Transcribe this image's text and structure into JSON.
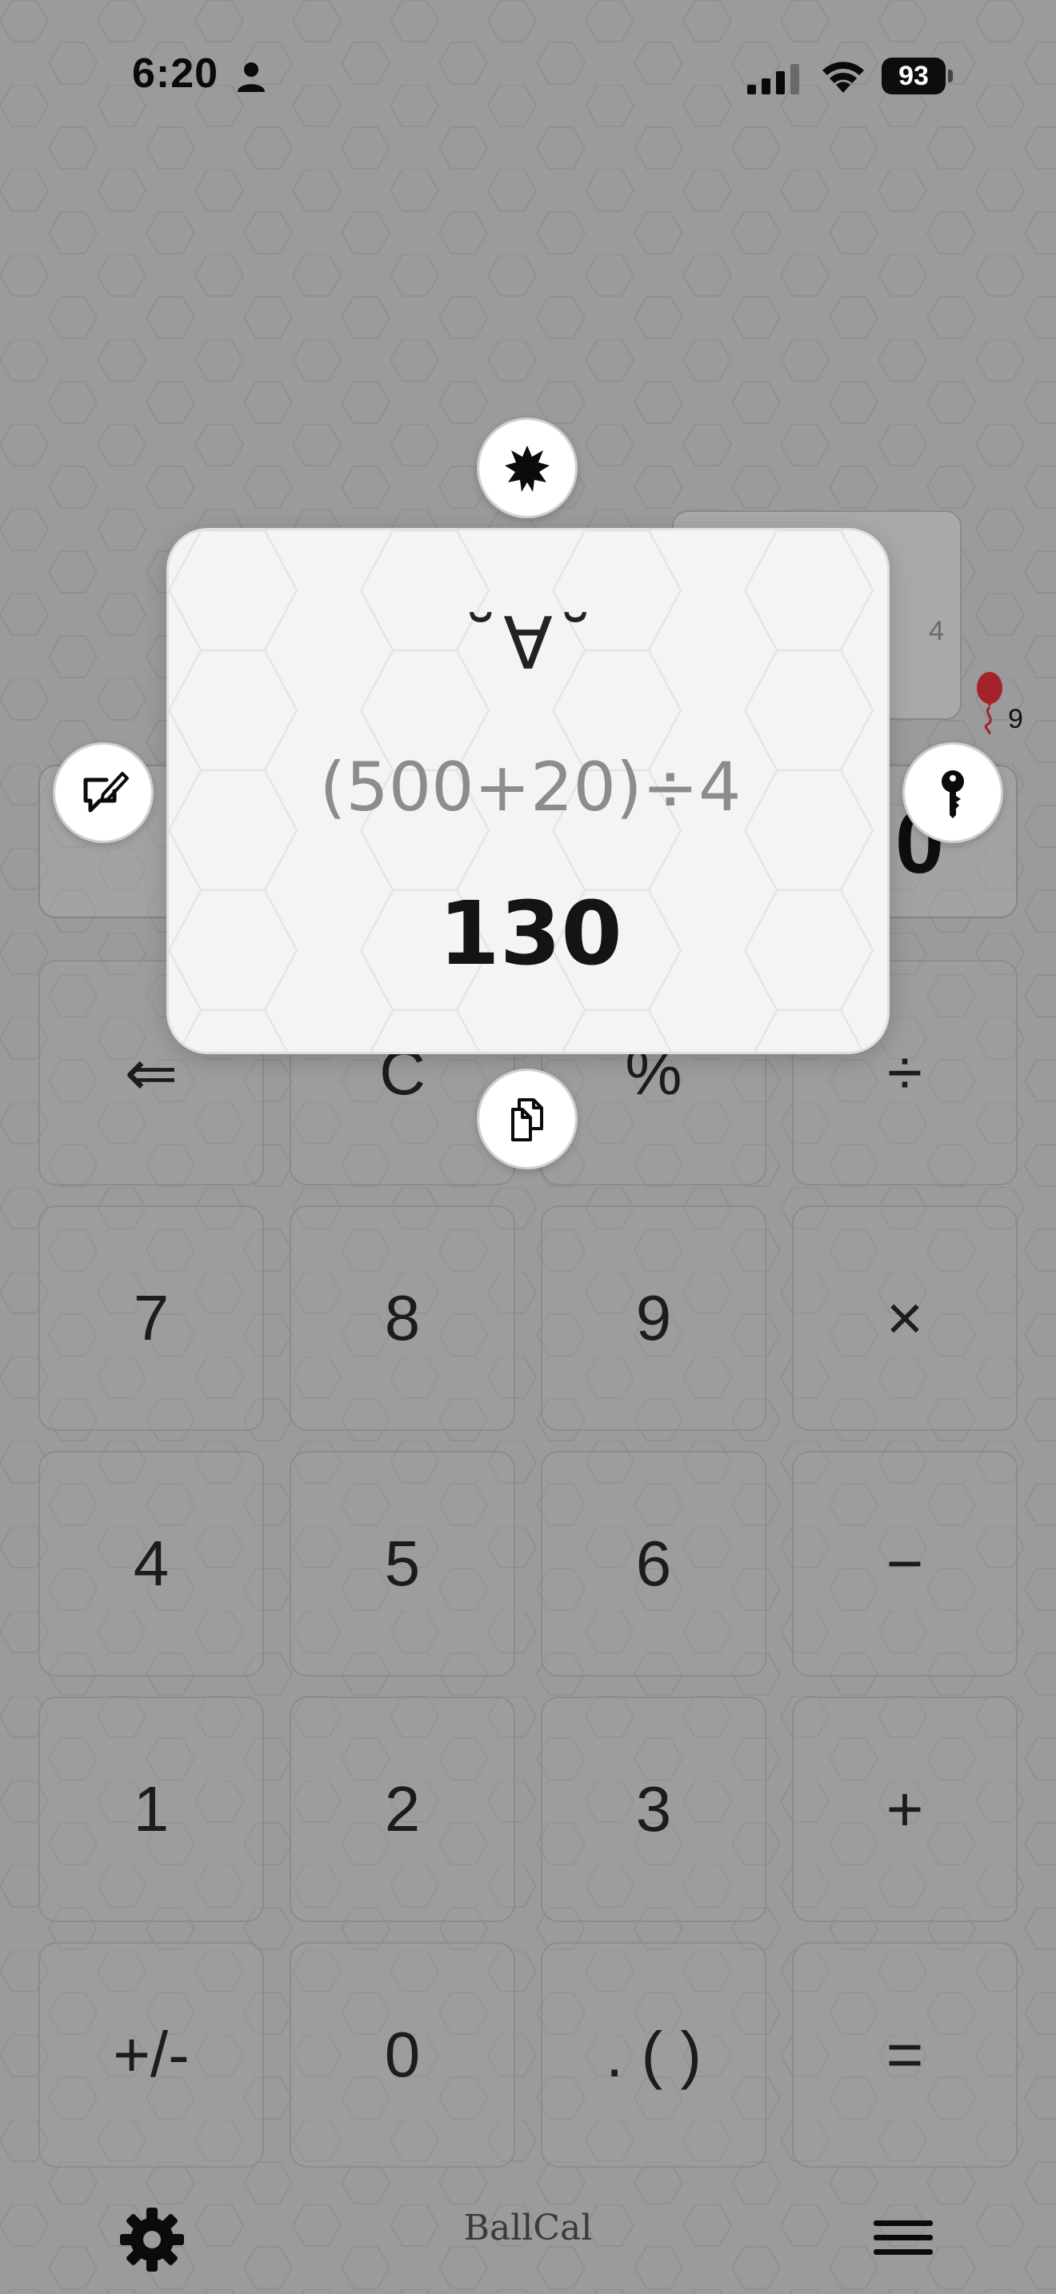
{
  "status_bar": {
    "time": "6:20",
    "battery": "93"
  },
  "background": {
    "history_snippet": "4",
    "display_value": "0",
    "balloon_count": "9"
  },
  "popup": {
    "face": "˘∀˘",
    "expression": "(500+20)÷4",
    "result": "130",
    "buttons": {
      "top": "sparkle-icon",
      "left": "edit-comment-icon",
      "right": "key-icon",
      "bottom": "copy-icon"
    }
  },
  "keypad": {
    "rows": [
      [
        "⇐",
        "C",
        "%",
        "÷"
      ],
      [
        "7",
        "8",
        "9",
        "×"
      ],
      [
        "4",
        "5",
        "6",
        "−"
      ],
      [
        "1",
        "2",
        "3",
        "+"
      ],
      [
        "+/-",
        "0",
        ". ( )",
        "="
      ]
    ]
  },
  "bottom_bar": {
    "settings_icon": "gear-icon",
    "app_name": "BallCal",
    "menu_icon": "hamburger-menu-icon"
  }
}
